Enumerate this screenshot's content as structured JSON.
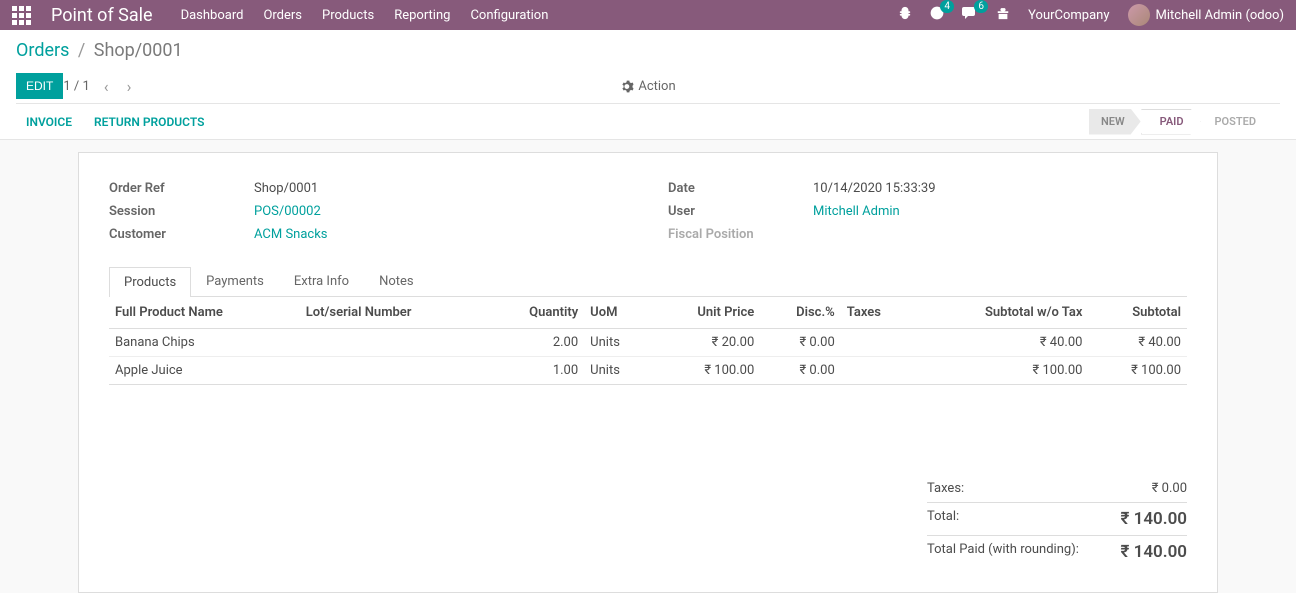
{
  "navbar": {
    "brand": "Point of Sale",
    "menu": [
      "Dashboard",
      "Orders",
      "Products",
      "Reporting",
      "Configuration"
    ],
    "badges": {
      "activities": "4",
      "messages": "6"
    },
    "company": "YourCompany",
    "user": "Mitchell Admin (odoo)"
  },
  "breadcrumb": {
    "link": "Orders",
    "current": "Shop/0001"
  },
  "buttons": {
    "edit": "EDIT",
    "action": "Action",
    "invoice": "INVOICE",
    "return": "RETURN PRODUCTS"
  },
  "pager": {
    "text": "1 / 1"
  },
  "status": {
    "new": "NEW",
    "paid": "PAID",
    "posted": "POSTED"
  },
  "fields": {
    "order_ref_label": "Order Ref",
    "order_ref": "Shop/0001",
    "session_label": "Session",
    "session": "POS/00002",
    "customer_label": "Customer",
    "customer": "ACM Snacks",
    "date_label": "Date",
    "date": "10/14/2020 15:33:39",
    "user_label": "User",
    "user": "Mitchell Admin",
    "fiscal_label": "Fiscal Position"
  },
  "tabs": [
    "Products",
    "Payments",
    "Extra Info",
    "Notes"
  ],
  "table": {
    "headers": {
      "name": "Full Product Name",
      "lot": "Lot/serial Number",
      "qty": "Quantity",
      "uom": "UoM",
      "price": "Unit Price",
      "disc": "Disc.%",
      "taxes": "Taxes",
      "sub_wo": "Subtotal w/o Tax",
      "sub": "Subtotal"
    },
    "rows": [
      {
        "name": "Banana Chips",
        "lot": "",
        "qty": "2.00",
        "uom": "Units",
        "price": "₹ 20.00",
        "disc": "₹ 0.00",
        "taxes": "",
        "sub_wo": "₹ 40.00",
        "sub": "₹ 40.00"
      },
      {
        "name": "Apple Juice",
        "lot": "",
        "qty": "1.00",
        "uom": "Units",
        "price": "₹ 100.00",
        "disc": "₹ 0.00",
        "taxes": "",
        "sub_wo": "₹ 100.00",
        "sub": "₹ 100.00"
      }
    ]
  },
  "totals": {
    "taxes_label": "Taxes:",
    "taxes": "₹ 0.00",
    "total_label": "Total:",
    "total": "₹ 140.00",
    "paid_label": "Total Paid (with rounding):",
    "paid": "₹ 140.00"
  }
}
